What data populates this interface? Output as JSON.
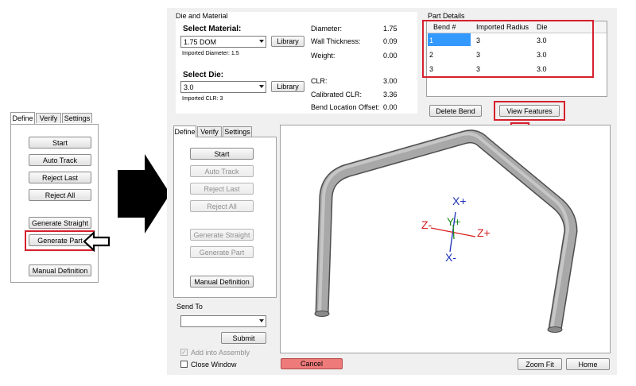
{
  "left_panel": {
    "tabs": [
      "Define",
      "Verify",
      "Settings"
    ],
    "buttons": {
      "start": "Start",
      "auto_track": "Auto Track",
      "reject_last": "Reject Last",
      "reject_all": "Reject All",
      "generate_straight": "Generate Straight",
      "generate_part": "Generate Part",
      "manual_definition": "Manual Definition"
    }
  },
  "die_material": {
    "group_title": "Die and Material",
    "select_material_label": "Select Material:",
    "material_value": "1.75 DOM",
    "library_label": "Library",
    "imported_diameter": "Imported Diameter: 1.5",
    "select_die_label": "Select Die:",
    "die_value": "3.0",
    "imported_clr": "Imported CLR: 3",
    "props": [
      {
        "label": "Diameter:",
        "value": "1.75"
      },
      {
        "label": "Wall Thickness:",
        "value": "0.09"
      },
      {
        "label": "Weight:",
        "value": "0.00"
      },
      {
        "label": "CLR:",
        "value": "3.00"
      },
      {
        "label": "Calibrated CLR:",
        "value": "3.36"
      },
      {
        "label": "Bend Location Offset:",
        "value": "0.00"
      }
    ]
  },
  "part_details": {
    "group_title": "Part Details",
    "columns": [
      "Bend #",
      "Imported Radius",
      "Die"
    ],
    "rows": [
      [
        "1",
        "3",
        "3.0"
      ],
      [
        "2",
        "3",
        "3.0"
      ],
      [
        "3",
        "3",
        "3.0"
      ]
    ],
    "delete_bend": "Delete Bend",
    "view_features": "View Features"
  },
  "define_panel": {
    "tabs": [
      "Define",
      "Verify",
      "Settings"
    ],
    "buttons": {
      "start": "Start",
      "auto_track": "Auto Track",
      "reject_last": "Reject Last",
      "reject_all": "Reject All",
      "generate_straight": "Generate Straight",
      "generate_part": "Generate Part",
      "manual_definition": "Manual Definition"
    }
  },
  "send_to": {
    "title": "Send To",
    "select_value": "",
    "submit": "Submit",
    "add_into_assembly": "Add into Assembly",
    "close_window": "Close Window"
  },
  "viewport": {
    "axes": {
      "x_plus": "X+",
      "x_minus": "X-",
      "y_plus": "Y+",
      "z_plus": "Z+",
      "z_minus": "Z-"
    },
    "cancel": "Cancel",
    "zoom_fit": "Zoom Fit",
    "home": "Home"
  },
  "colors": {
    "highlight_red": "#d6202c",
    "selection_blue": "#3399ff",
    "cancel_bg": "#ee7a7a",
    "axis_x": "#1c2fb8",
    "axis_z": "#d82020",
    "axis_y": "#1e8a1e"
  }
}
